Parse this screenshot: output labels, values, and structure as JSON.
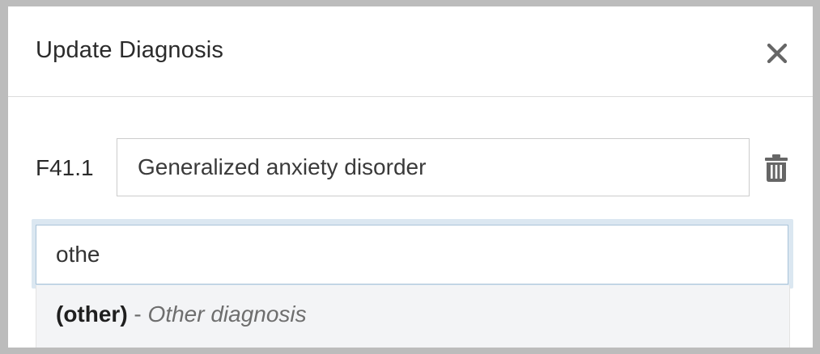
{
  "modal": {
    "title": "Update Diagnosis",
    "close_icon": "close-icon"
  },
  "diagnosis": {
    "code": "F41.1",
    "value": "Generalized anxiety disorder",
    "delete_icon": "trash-icon"
  },
  "search": {
    "value": "othe"
  },
  "suggestions": [
    {
      "code": "(other)",
      "separator": " - ",
      "description": "Other diagnosis"
    }
  ]
}
